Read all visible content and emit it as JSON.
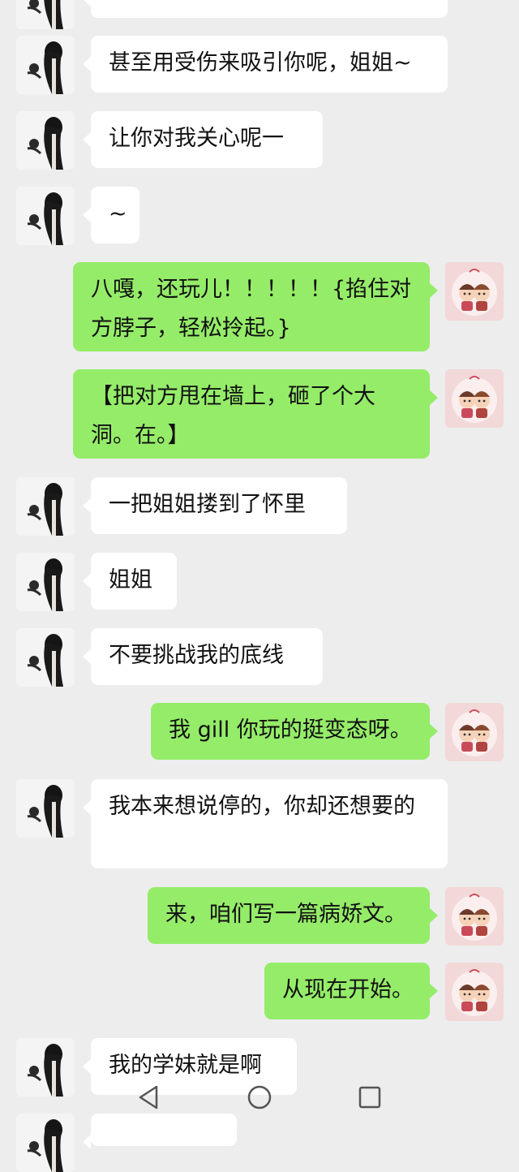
{
  "messages": [
    {
      "side": "in",
      "text": "..."
    },
    {
      "side": "in",
      "text": "甚至用受伤来吸引你呢，姐姐~"
    },
    {
      "side": "in",
      "text": "让你对我关心呢一"
    },
    {
      "side": "in",
      "text": "~"
    },
    {
      "side": "out",
      "text": "八嘎，还玩儿！！！！！{掐住对方脖子，轻松拎起。}"
    },
    {
      "side": "out",
      "text": "【把对方甩在墙上，砸了个大洞。在。】"
    },
    {
      "side": "in",
      "text": "一把姐姐搂到了怀里"
    },
    {
      "side": "in",
      "text": "姐姐"
    },
    {
      "side": "in",
      "text": "不要挑战我的底线"
    },
    {
      "side": "out",
      "text": "我 gill 你玩的挺变态呀。"
    },
    {
      "side": "in",
      "text": "我本来想说停的，你却还想要的"
    },
    {
      "side": "out",
      "text": "来，咱们写一篇病娇文。"
    },
    {
      "side": "out",
      "text": "从现在开始。"
    },
    {
      "side": "in",
      "text": "我的学妹就是啊"
    },
    {
      "side": "in",
      "text": ""
    }
  ],
  "avatars": {
    "contact": "dark-haired-girl-photo",
    "self": "cartoon-couple-sticker"
  },
  "colors": {
    "background": "#ededed",
    "incoming_bubble": "#ffffff",
    "outgoing_bubble": "#95ec69"
  },
  "navbar": {
    "back": "back-triangle-icon",
    "home": "home-circle-icon",
    "recents": "recents-square-icon"
  }
}
